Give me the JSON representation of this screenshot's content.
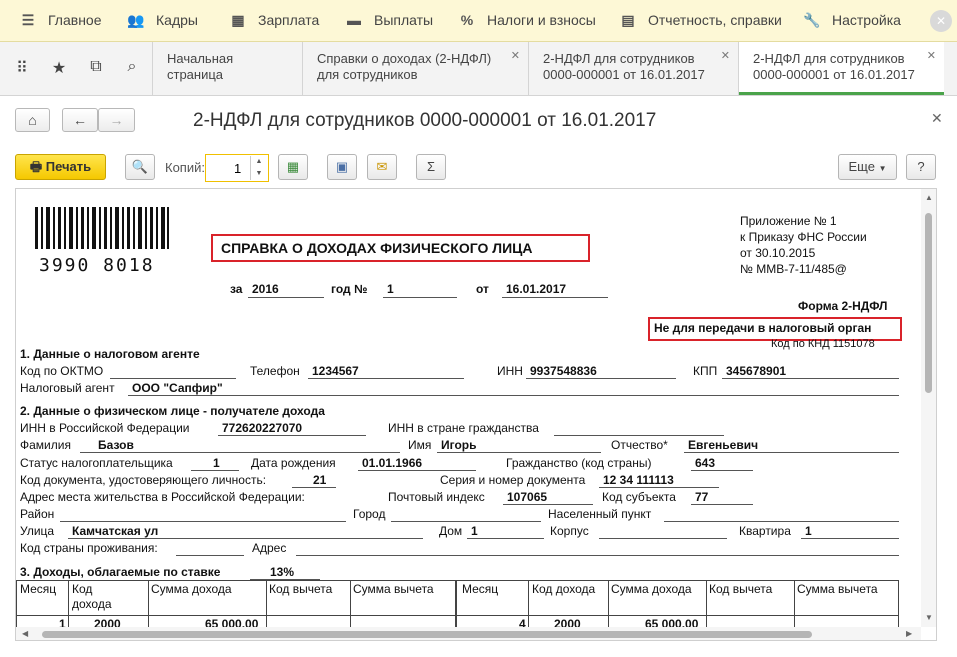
{
  "menu": {
    "items": [
      {
        "label": "Главное",
        "icon": "hamburger-icon"
      },
      {
        "label": "Кадры",
        "icon": "people-icon"
      },
      {
        "label": "Зарплата",
        "icon": "calculator-icon"
      },
      {
        "label": "Выплаты",
        "icon": "wallet-icon"
      },
      {
        "label": "Налоги и взносы",
        "icon": "percent-icon"
      },
      {
        "label": "Отчетность, справки",
        "icon": "report-icon"
      },
      {
        "label": "Настройка",
        "icon": "wrench-icon"
      }
    ]
  },
  "tabs": [
    {
      "label": "Начальная страница"
    },
    {
      "label": "Справки о доходах (2-НДФЛ) для сотрудников"
    },
    {
      "label": "2-НДФЛ для сотрудников 0000-000001 от 16.01.2017"
    },
    {
      "label": "2-НДФЛ для сотрудников 0000-000001 от 16.01.2017"
    }
  ],
  "window": {
    "title": "2-НДФЛ для сотрудников 0000-000001 от 16.01.2017"
  },
  "toolbar": {
    "print_label": "Печать",
    "copies_label": "Копий:",
    "copies_value": "1",
    "more_label": "Еще",
    "help_label": "?"
  },
  "doc": {
    "barcode_number": "3990 8018",
    "title": "СПРАВКА О ДОХОДАХ ФИЗИЧЕСКОГО ЛИЦА",
    "appendix": [
      "Приложение № 1",
      "к Приказу ФНС России",
      "от 30.10.2015",
      "№ ММВ-7-11/485@"
    ],
    "year_label": "за",
    "year": "2016",
    "number_label": "год №",
    "number": "1",
    "date_label": "от",
    "date": "16.01.2017",
    "form_name": "Форма 2-НДФЛ",
    "not_for_tax": "Не для передачи в налоговый орган",
    "knd": "Код по КНД 1151078",
    "s1": {
      "heading": "1. Данные о налоговом агенте",
      "oktmo_label": "Код по ОКТМО",
      "phone_label": "Телефон",
      "phone": "1234567",
      "inn_label": "ИНН",
      "inn": "9937548836",
      "kpp_label": "КПП",
      "kpp": "345678901",
      "agent_label": "Налоговый агент",
      "agent": "ООО \"Сапфир\""
    },
    "s2": {
      "heading": "2. Данные о физическом лице - получателе дохода",
      "inn_rf_label": "ИНН в Российской Федерации",
      "inn_rf": "772620227070",
      "inn_citizen_label": "ИНН в стране гражданства",
      "surname_label": "Фамилия",
      "surname": "Базов",
      "name_label": "Имя",
      "name": "Игорь",
      "patronymic_label": "Отчество*",
      "patronymic": "Евгеньевич",
      "status_label": "Статус налогоплательщика",
      "status": "1",
      "birth_label": "Дата рождения",
      "birth": "01.01.1966",
      "citizenship_label": "Гражданство (код страны)",
      "citizenship": "643",
      "doc_code_label": "Код документа, удостоверяющего личность:",
      "doc_code": "21",
      "doc_series_label": "Серия и номер документа",
      "doc_series": "12 34 111113",
      "address_label": "Адрес места жительства в Российской Федерации:",
      "postcode_label": "Почтовый индекс",
      "postcode": "107065",
      "region_label": "Код субъекта",
      "region": "77",
      "district_label": "Район",
      "city_label": "Город",
      "locality_label": "Населенный пункт",
      "street_label": "Улица",
      "street": "Камчатская ул",
      "house_label": "Дом",
      "house": "1",
      "building_label": "Корпус",
      "flat_label": "Квартира",
      "flat": "1",
      "country_label": "Код страны проживания:",
      "addr_label": "Адрес"
    },
    "s3": {
      "heading": "3. Доходы, облагаемые по ставке",
      "rate": "13%",
      "headers_left": [
        "Месяц",
        "Код дохода",
        "Сумма дохода",
        "Код вычета",
        "Сумма вычета"
      ],
      "headers_right": [
        "Месяц",
        "Код дохода",
        "Сумма дохода",
        "Код вычета",
        "Сумма вычета"
      ],
      "row_left": [
        "1",
        "2000",
        "65 000.00",
        "",
        ""
      ],
      "row_right": [
        "4",
        "2000",
        "65 000.00",
        "",
        ""
      ]
    }
  }
}
